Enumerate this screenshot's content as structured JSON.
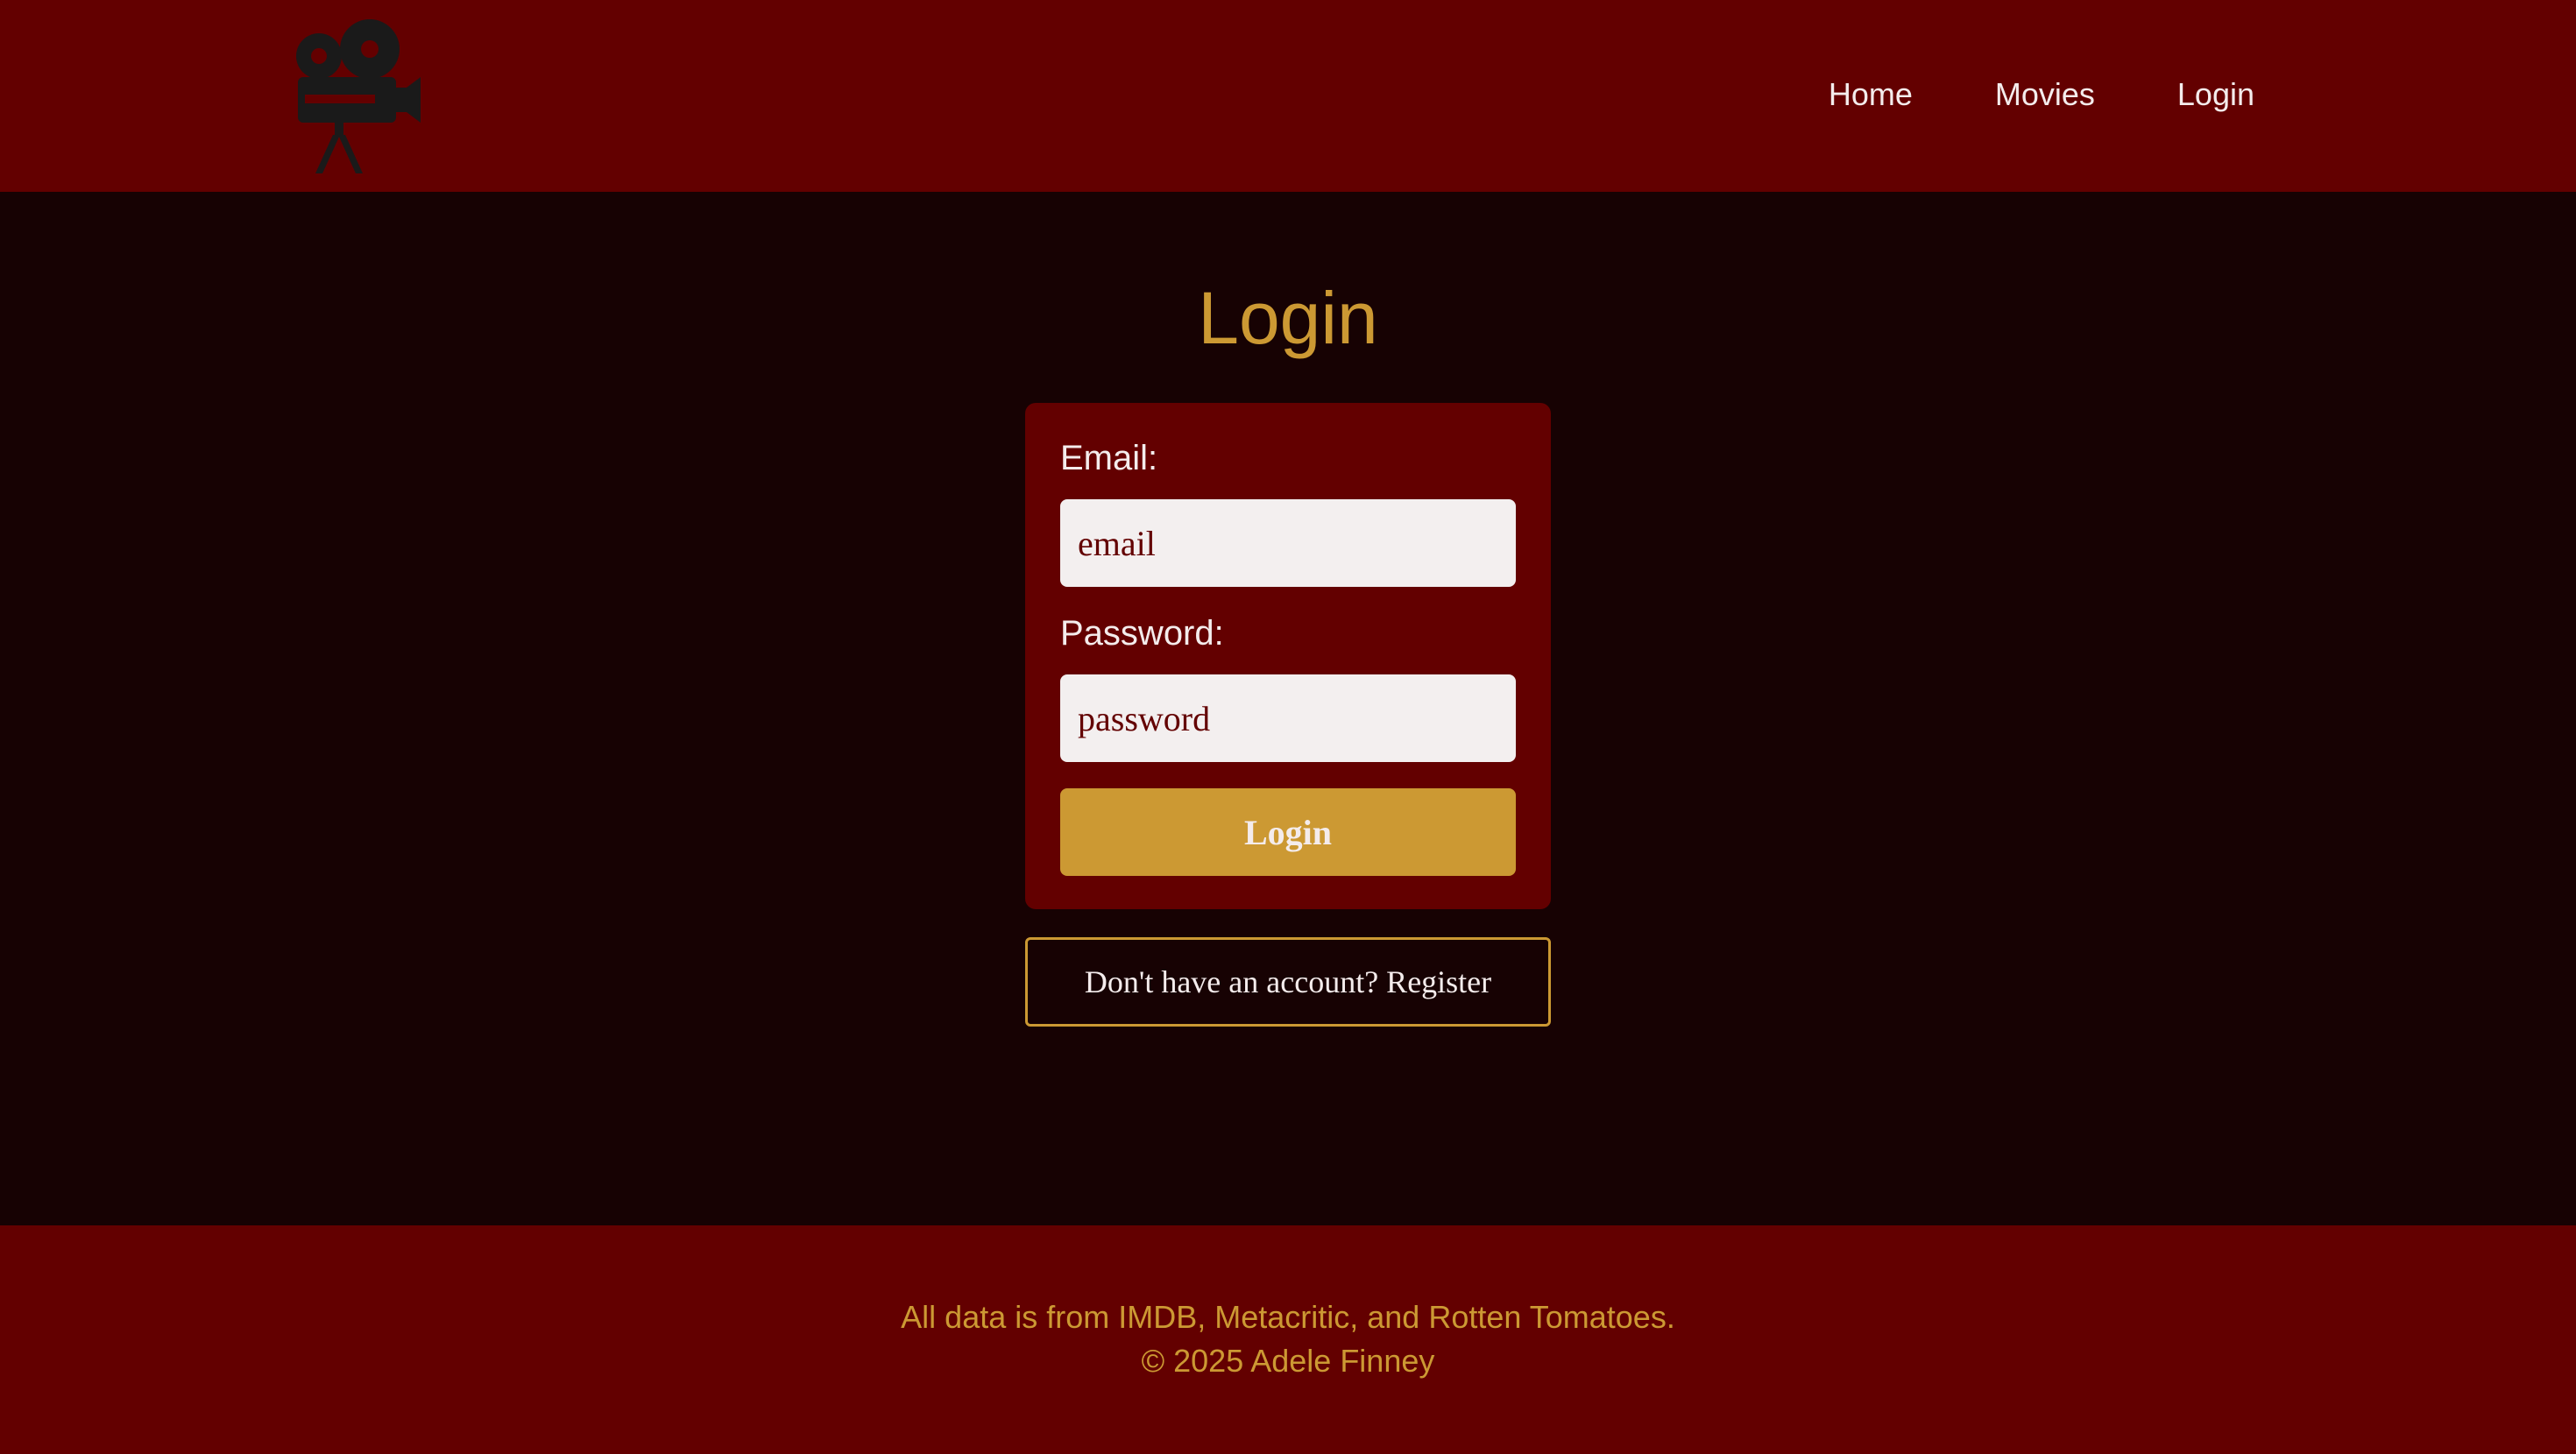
{
  "header": {
    "logo_icon": "movie-camera-icon",
    "nav": {
      "home": "Home",
      "movies": "Movies",
      "login": "Login"
    }
  },
  "main": {
    "title": "Login",
    "form": {
      "email_label": "Email:",
      "email_placeholder": "email",
      "email_value": "",
      "password_label": "Password:",
      "password_placeholder": "password",
      "password_value": "",
      "submit_label": "Login"
    },
    "register_label": "Don't have an account? Register"
  },
  "footer": {
    "line1": "All data is from IMDB, Metacritic, and Rotten Tomatoes.",
    "line2": "© 2025 Adele Finney"
  },
  "colors": {
    "header_bg": "#630000",
    "page_bg": "#170203",
    "accent": "#cc9933",
    "text_light": "#f4ecec",
    "input_bg": "#f3efef",
    "logo": "#1a1a1a"
  }
}
